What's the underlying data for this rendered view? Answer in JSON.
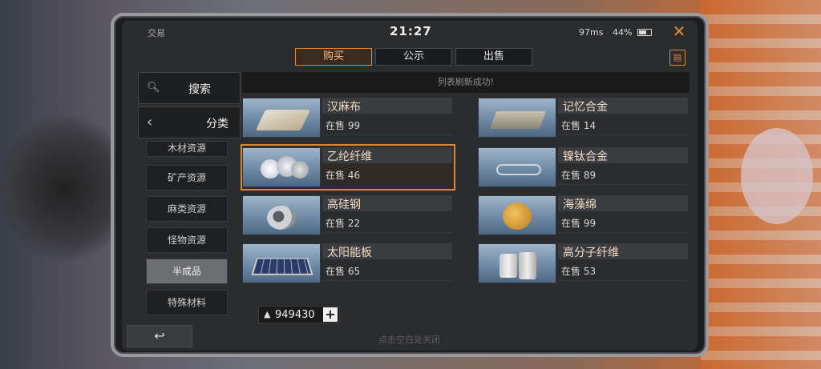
{
  "status": {
    "title": "交易",
    "clock": "21:27",
    "ping": "97ms",
    "battery": "44%"
  },
  "tabs": [
    {
      "label": "购买",
      "active": true
    },
    {
      "label": "公示",
      "active": false
    },
    {
      "label": "出售",
      "active": false
    }
  ],
  "notice": "列表刷新成功!",
  "left_menu": {
    "search_label": "搜索",
    "category_label": "分类"
  },
  "subcategories": [
    {
      "label": "木材资源"
    },
    {
      "label": "矿产资源"
    },
    {
      "label": "麻类资源"
    },
    {
      "label": "怪物资源"
    },
    {
      "label": "半成品",
      "active": true
    },
    {
      "label": "特殊材料"
    }
  ],
  "items": [
    {
      "name": "汉麻布",
      "count": "在售 99",
      "icon": "cloth-icon"
    },
    {
      "name": "记忆合金",
      "count": "在售 14",
      "icon": "alloy-bar-icon"
    },
    {
      "name": "乙纶纤维",
      "count": "在售 46",
      "icon": "fiber-icon",
      "selected": true
    },
    {
      "name": "镍钛合金",
      "count": "在售 89",
      "icon": "wire-icon"
    },
    {
      "name": "高硅钢",
      "count": "在售 22",
      "icon": "steel-roll-icon"
    },
    {
      "name": "海藻绵",
      "count": "在售 99",
      "icon": "sponge-icon"
    },
    {
      "name": "太阳能板",
      "count": "在售 65",
      "icon": "solar-panel-icon"
    },
    {
      "name": "高分子纤维",
      "count": "在售 53",
      "icon": "spool-icon"
    }
  ],
  "currency": {
    "value": "949430",
    "icon": "coin-icon"
  },
  "footer_hint": "点击空白处关闭",
  "colors": {
    "accent": "#e08a3a",
    "panel": "#2b2c2e"
  }
}
